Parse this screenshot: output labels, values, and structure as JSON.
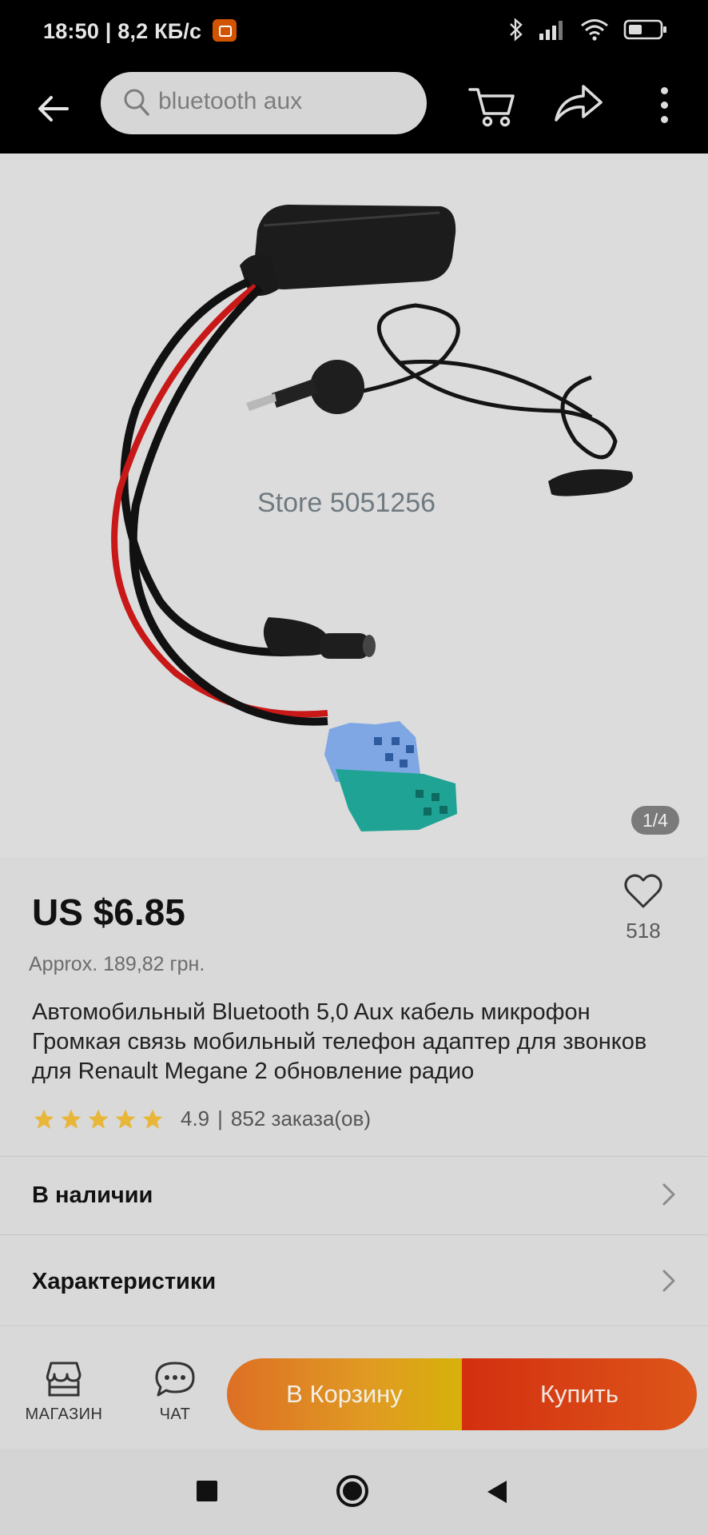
{
  "status_bar": {
    "time": "18:50",
    "speed": "8,2 КБ/с",
    "separator": "|"
  },
  "top_bar": {
    "search_query": "bluetooth aux",
    "icons": [
      "back-arrow-icon",
      "search-icon",
      "cart-icon",
      "share-icon",
      "more-icon"
    ]
  },
  "gallery": {
    "watermark": "Store 5051256",
    "counter": "1/4"
  },
  "product": {
    "price": "US $6.85",
    "approx": "Approx. 189,82 грн.",
    "favorites": "518",
    "title": "Автомобильный Bluetooth 5,0 Aux кабель микрофон Громкая связь мобильный телефон адаптер для звонков для Renault Megane 2 обновление радио",
    "rating": "4.9",
    "rating_sep": "|",
    "orders": "852 заказа(ов)",
    "stars": 5,
    "star_color": "#e8b73a"
  },
  "sections": {
    "availability": "В наличии",
    "specs": "Характеристики"
  },
  "actions": {
    "store": "МАГАЗИН",
    "chat": "ЧАТ",
    "add_to_cart": "В Корзину",
    "buy": "Купить"
  },
  "colors": {
    "cart_gradient_start": "#dd6f24",
    "cart_gradient_end": "#d7b10a",
    "buy_color": "#d32f10"
  }
}
